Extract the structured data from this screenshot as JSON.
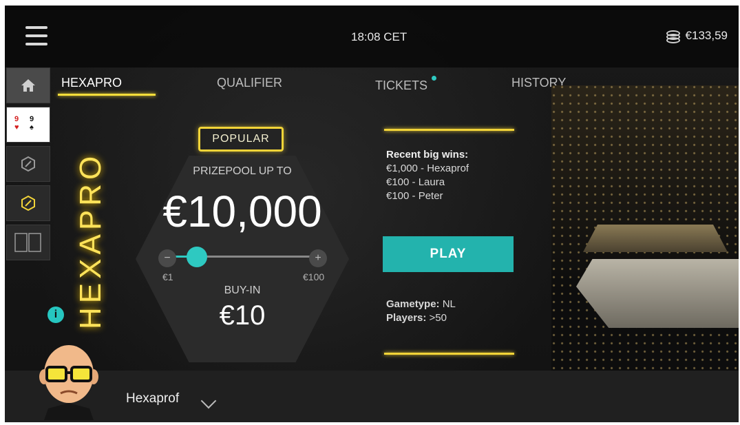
{
  "header": {
    "time": "18:08 CET",
    "balance": "€133,59"
  },
  "tabs": [
    {
      "label": "HEXAPRO",
      "active": true
    },
    {
      "label": "QUALIFIER",
      "active": false
    },
    {
      "label": "TICKETS",
      "active": false,
      "has_notification_dot": true
    },
    {
      "label": "HISTORY",
      "active": false
    }
  ],
  "sidebar": {
    "items": [
      {
        "icon": "home-icon"
      },
      {
        "icon": "cards-icon",
        "cards": [
          "9",
          "9"
        ]
      },
      {
        "icon": "hexapro-grey-icon"
      },
      {
        "icon": "hexapro-yellow-icon"
      },
      {
        "icon": "tickets-icon"
      }
    ]
  },
  "brand": {
    "neon_logo": "HEXAPRO"
  },
  "game": {
    "badge": "POPULAR",
    "prizepool_label": "PRIZEPOOL UP TO",
    "prizepool_value": "€10,000",
    "slider": {
      "min_label": "€1",
      "max_label": "€100",
      "decrement": "−",
      "increment": "+",
      "value_fraction": 0.2
    },
    "buyin_label": "BUY-IN",
    "buyin_value": "€10"
  },
  "details": {
    "recent_title": "Recent big wins:",
    "recent_wins": [
      "€1,000 - Hexaprof",
      "€100 - Laura",
      "€100 - Peter"
    ],
    "play_label": "PLAY",
    "gametype_label": "Gametype:",
    "gametype_value": "NL",
    "players_label": "Players:",
    "players_value": ">50"
  },
  "user": {
    "name": "Hexaprof"
  },
  "colors": {
    "accent_teal": "#23b3ad",
    "neon_yellow": "#f2d438",
    "background": "#141414"
  }
}
